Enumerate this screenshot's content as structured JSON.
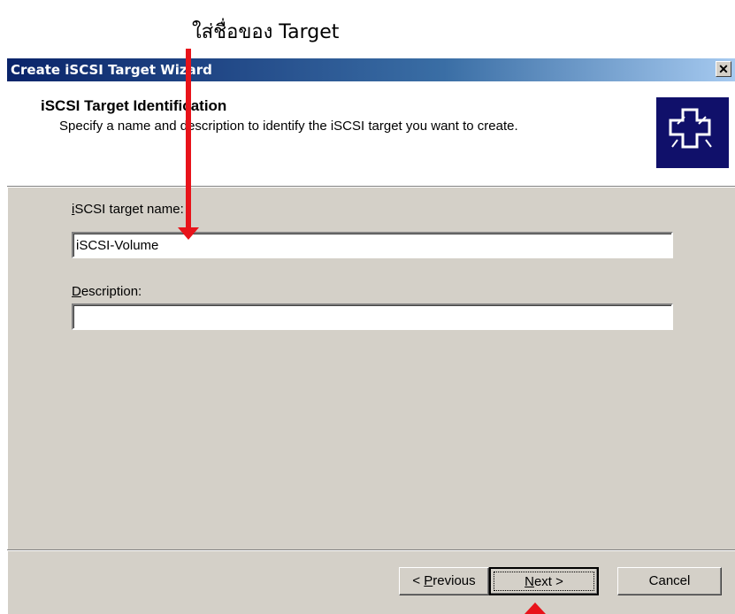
{
  "annotation": {
    "text": "ใส่ชื่อของ Target"
  },
  "window": {
    "title": "Create iSCSI Target Wizard",
    "close_glyph": "✕"
  },
  "header": {
    "title": "iSCSI Target Identification",
    "subtitle": "Specify a name and description to identify the iSCSI target you want to create."
  },
  "form": {
    "name_label_accel": "i",
    "name_label_rest": "SCSI target name:",
    "name_value": "iSCSI-Volume",
    "desc_label_accel": "D",
    "desc_label_rest": "escription:",
    "desc_value": ""
  },
  "buttons": {
    "previous_prefix": "< ",
    "previous_accel": "P",
    "previous_rest": "revious",
    "next_accel": "N",
    "next_rest": "ext >",
    "cancel": "Cancel"
  },
  "colors": {
    "arrow": "#e8131a",
    "title_start": "#0a246a",
    "title_end": "#a6caf0"
  },
  "icons": [
    "close-icon",
    "wizard-puzzle-icon"
  ]
}
